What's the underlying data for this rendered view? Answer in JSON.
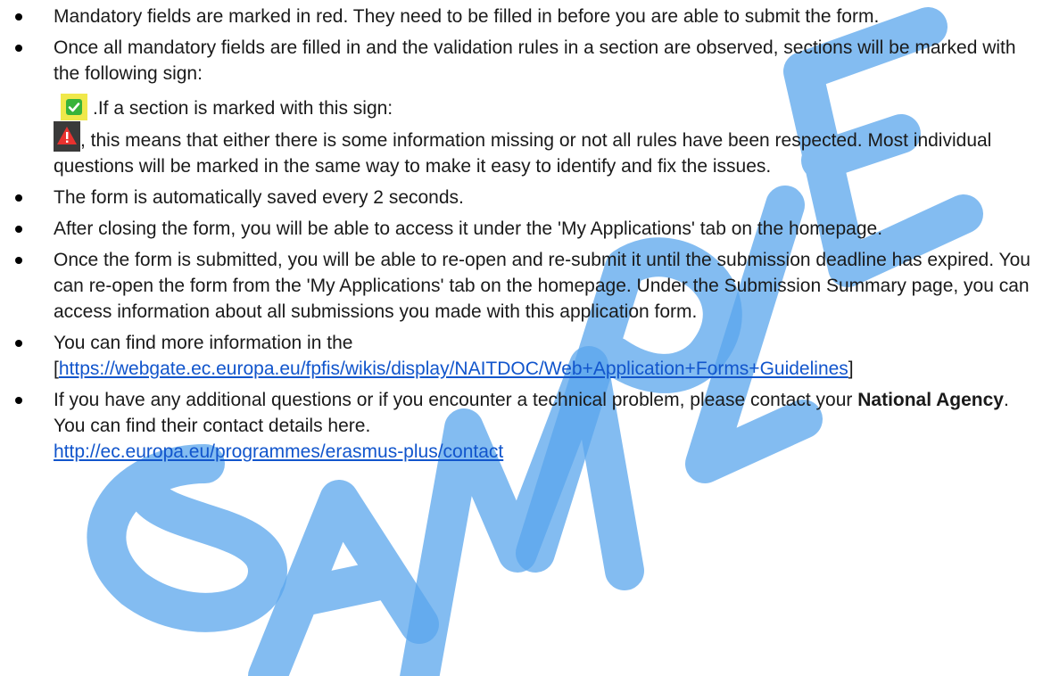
{
  "watermark": {
    "text": "SAMPLE",
    "color": "#4f9be6"
  },
  "bullets": [
    {
      "text": "Mandatory fields are marked in red. They need to be filled in before you are able to submit the form."
    },
    {
      "text_before_ok_icon": "Once all mandatory fields are filled in and the validation rules in a section are observed, sections will be marked with the following sign:",
      "ok_icon": "checkmark-icon",
      "text_after_ok_icon": ".If a section is marked with this sign:",
      "warning_icon": "warning-icon",
      "text_after_warning_icon": ", this means that either there is some information missing or not all rules have been respected. Most individual questions will be marked in the same way to make it easy to identify and fix the issues."
    },
    {
      "text": "The form is automatically saved every 2 seconds."
    },
    {
      "text": "After closing the form, you will be able to access it under the 'My Applications' tab on the homepage."
    },
    {
      "text": "Once the form is submitted, you will be able to re-open and re-submit it until the submission deadline has expired. You can re-open the form from the 'My Applications' tab on the homepage. Under the Submission Summary page, you can access information about all submissions you made with this application form."
    },
    {
      "text": "You can find more information in the",
      "link_open_bracket": "[",
      "link": "https://webgate.ec.europa.eu/fpfis/wikis/display/NAITDOC/Web+Application+Forms+Guidelines",
      "link_close_bracket": "]"
    },
    {
      "text_before_bold": "If you have any additional questions or if you encounter a technical problem, please contact your",
      "bold": "National Agency",
      "text_after_bold": ". You can find their contact details here.",
      "link": "http://ec.europa.eu/programmes/erasmus-plus/contact"
    }
  ]
}
